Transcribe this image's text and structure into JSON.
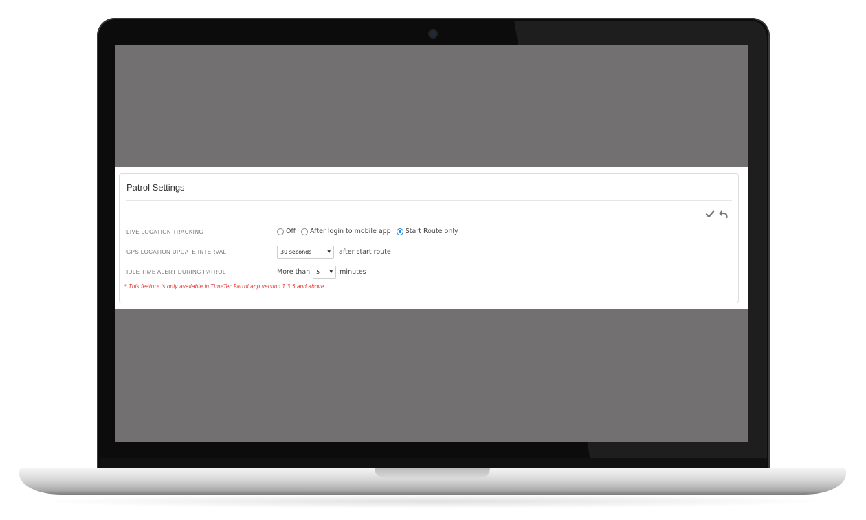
{
  "panel": {
    "title": "Patrol Settings",
    "toolbar": {
      "save_icon": "check-icon",
      "undo_icon": "undo-icon"
    },
    "rows": {
      "live_tracking": {
        "label": "LIVE LOCATION TRACKING",
        "options": [
          "Off",
          "After login to mobile app",
          "Start Route only"
        ],
        "selected": "Start Route only"
      },
      "gps_interval": {
        "label": "GPS LOCATION UPDATE INTERVAL",
        "value": "30 seconds",
        "suffix": "after start route"
      },
      "idle_alert": {
        "label": "IDLE TIME ALERT DURING PATROL",
        "prefix": "More than",
        "value": "5",
        "suffix": "minutes"
      }
    },
    "note": "* This feature is only available in TimeTec Patrol app version 1.3.5 and above."
  },
  "colors": {
    "accent": "#1e88e5",
    "note": "#e53935",
    "screen_background": "#737071"
  }
}
